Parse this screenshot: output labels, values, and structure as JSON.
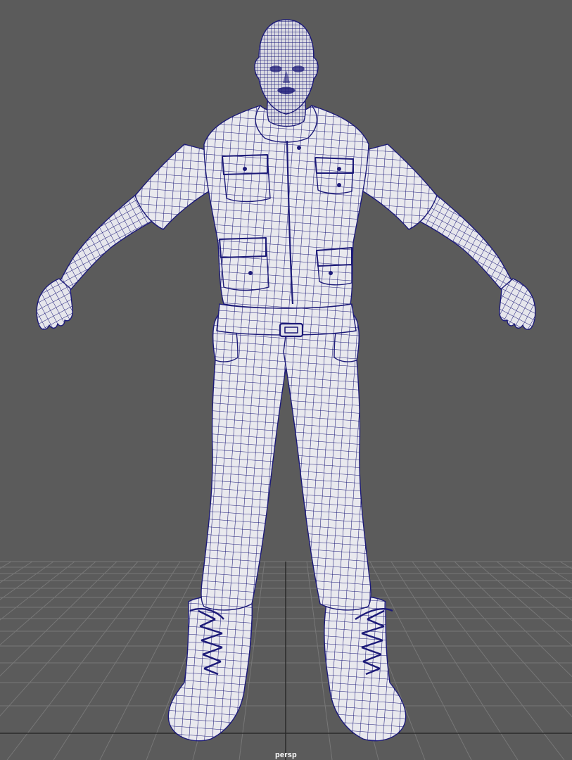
{
  "viewport": {
    "camera_name": "persp",
    "display_mode": "wireframe-on-shaded",
    "background_color": "#5b5b5b",
    "grid_color": "#767676",
    "grid_major_color": "#2c2c2c",
    "mesh_fill_color": "#e8e8ec",
    "wireframe_color": "#1c1a78"
  }
}
